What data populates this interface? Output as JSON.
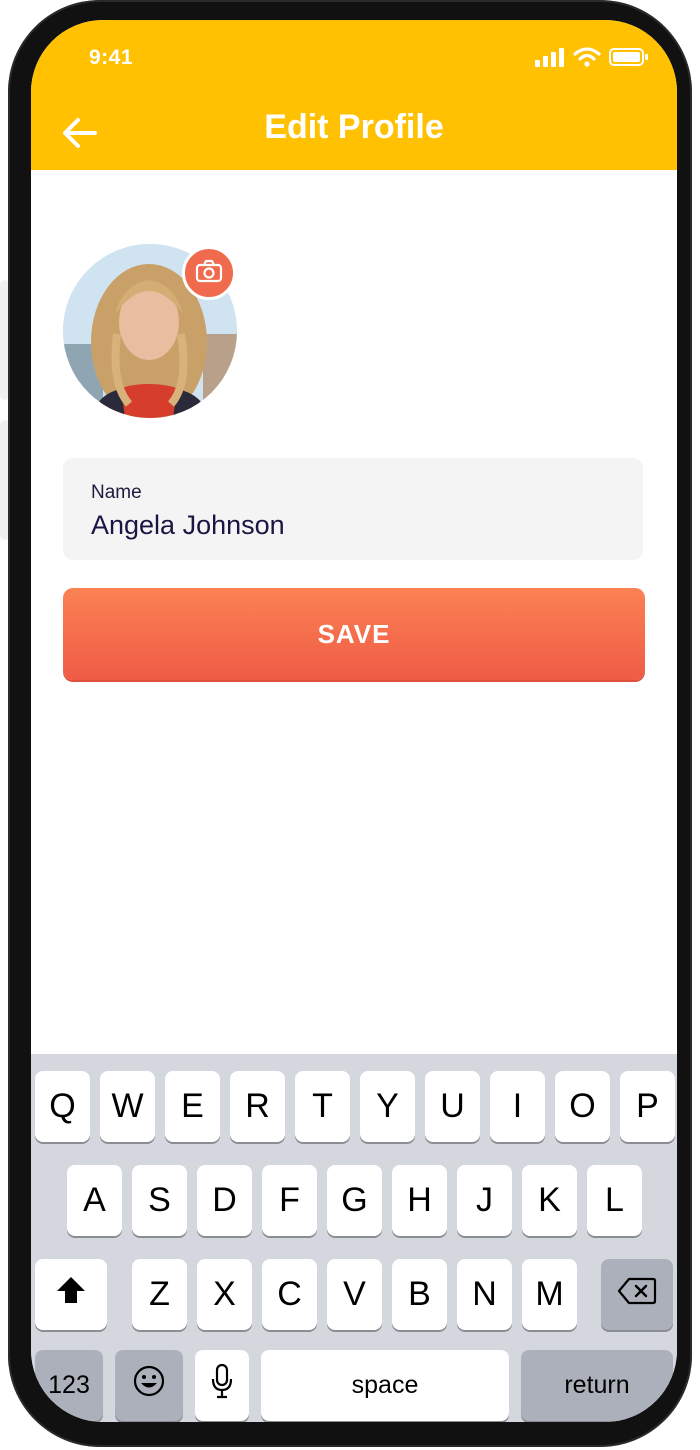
{
  "status_bar": {
    "time": "9:41"
  },
  "header": {
    "title": "Edit Profile"
  },
  "profile": {
    "name_label": "Name",
    "name_value": "Angela Johnson"
  },
  "save_label": "SAVE",
  "colors": {
    "header_bg": "#ffc102",
    "accent": "#f06a4e",
    "button_top": "#fb8253",
    "button_bottom": "#ef5b46"
  },
  "keyboard": {
    "row1": [
      "Q",
      "W",
      "E",
      "R",
      "T",
      "Y",
      "U",
      "I",
      "O",
      "P"
    ],
    "row2": [
      "A",
      "S",
      "D",
      "F",
      "G",
      "H",
      "J",
      "K",
      "L"
    ],
    "row3": [
      "Z",
      "X",
      "C",
      "V",
      "B",
      "N",
      "M"
    ],
    "numbers_label": "123",
    "space_label": "space",
    "return_label": "return"
  }
}
